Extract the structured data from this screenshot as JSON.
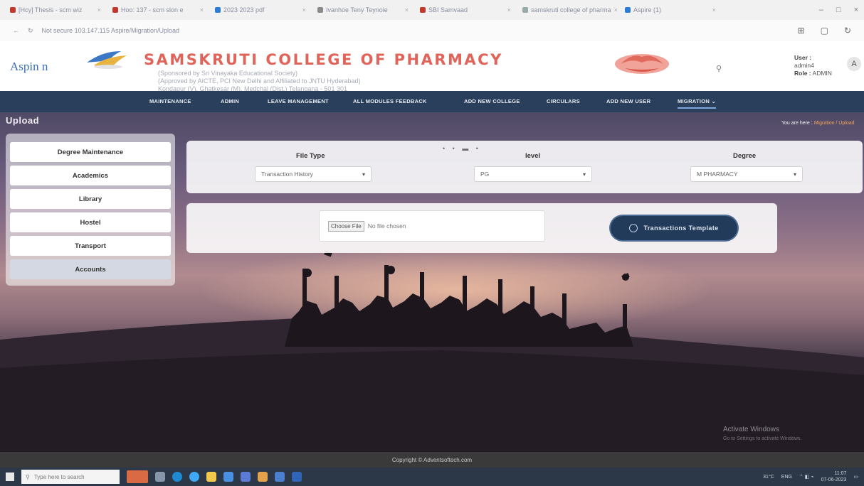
{
  "browser": {
    "tabs": [
      {
        "label": "[Hcy] Thesis - scm wiz"
      },
      {
        "label": "Hoo: 137 - scm slon e"
      },
      {
        "label": "2023 2023 pdf"
      },
      {
        "label": "Ivanhoe Teny Teynoie"
      },
      {
        "label": "SBI Samvaad"
      },
      {
        "label": "samskruti college of pharma"
      },
      {
        "label": "Aspire (1)"
      }
    ],
    "url": "Not secure   103.147.115 Aspire/Migration/Upload"
  },
  "header": {
    "logo_text": "Aspin n",
    "college_name": "SAMSKRUTI COLLEGE OF PHARMACY",
    "sub_lines": [
      "(Sponsored by Sri Vinayaka Educational Society)",
      "(Approved by AICTE, PCI New Delhi and Affiliated to JNTU Hyderabad)",
      "Kondapur (V), Ghatkesar (M), Medchal (Dist.) Telangana - 501 301"
    ],
    "user_label": "User :",
    "user_name": "admin4",
    "role_label": "Role :",
    "role_value": "ADMIN",
    "avatar_letter": "A"
  },
  "nav": {
    "items": [
      "MAINTENANCE",
      "ADMIN",
      "LEAVE MANAGEMENT",
      "ALL MODULES FEEDBACK",
      "ADD NEW COLLEGE",
      "CIRCULARS",
      "ADD NEW USER",
      "MIGRATION"
    ]
  },
  "page": {
    "title": "Upload",
    "breadcrumb_prefix": "You are here :",
    "breadcrumb_current": "Migration / Upload"
  },
  "sidebar": {
    "items": [
      {
        "label": "Degree Maintenance"
      },
      {
        "label": "Academics"
      },
      {
        "label": "Library"
      },
      {
        "label": "Hostel"
      },
      {
        "label": "Transport"
      },
      {
        "label": "Accounts"
      }
    ]
  },
  "form": {
    "file_type_label": "File Type",
    "file_type_value": "Transaction History",
    "level_label": "level",
    "level_value": "PG",
    "degree_label": "Degree",
    "degree_value": "M PHARMACY",
    "choose_file_label": "Choose File",
    "no_file_text": "No file chosen",
    "template_button": "Transactions Template"
  },
  "watermark": {
    "title": "Activate Windows",
    "subtitle": "Go to Settings to activate Windows."
  },
  "footer": {
    "text": "Copyright © Adventsoftech.com"
  },
  "taskbar": {
    "search_placeholder": "Type here to search",
    "weather": "31°C",
    "tray_text": "ENG",
    "time": "11:07",
    "date": "07-06-2023"
  },
  "colors": {
    "nav_bg": "#2a3f5c",
    "college_name": "#e0645a",
    "button_bg": "#233b5b",
    "breadcrumb_highlight": "#f5a25a"
  }
}
